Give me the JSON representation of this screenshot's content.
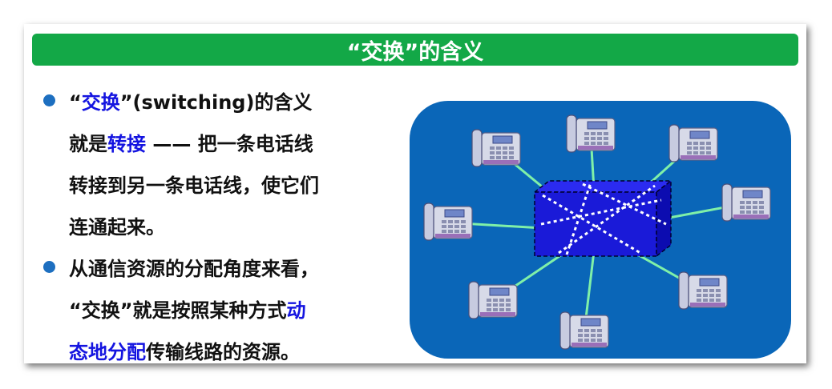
{
  "title": "“交换”的含义",
  "bullets": [
    {
      "lines": [
        [
          "“",
          {
            "hl": "交换"
          },
          "”(switching)的含义"
        ],
        [
          "就是",
          {
            "hl": "转接"
          },
          " —— 把一条电话线"
        ],
        [
          "转接到另一条电话线，使它们"
        ],
        [
          "连通起来。"
        ]
      ]
    },
    {
      "lines": [
        [
          "从通信资源的分配角度来看，"
        ],
        [
          "“交换”就是按照某种方式",
          {
            "hl": "动"
          }
        ],
        [
          {
            "hl": "态地分配"
          },
          "传输线路的资源。"
        ]
      ]
    }
  ],
  "colors": {
    "title_bar": "#13a847",
    "bullet_dot": "#1d6fc0",
    "highlight": "#1414e0",
    "diagram_bg": "#0a66b8",
    "switch_box": "#1a1ad8",
    "link_line": "#7ff0a8"
  },
  "diagram": {
    "center_node": "switch-box",
    "nodes": [
      "telephone",
      "telephone",
      "telephone",
      "telephone",
      "telephone",
      "telephone",
      "telephone",
      "telephone"
    ]
  }
}
